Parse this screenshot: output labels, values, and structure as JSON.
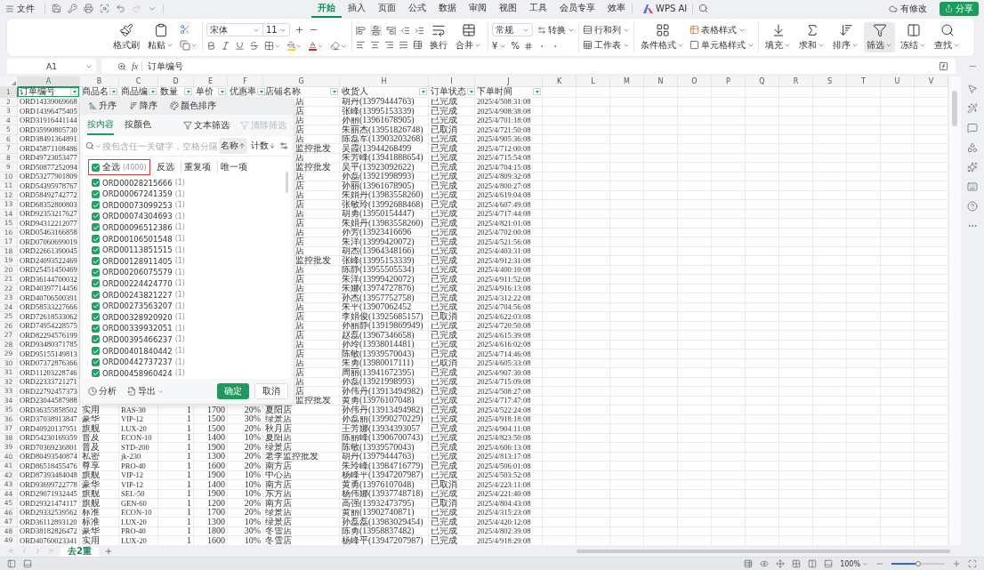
{
  "top_bar": {
    "menu": "文件",
    "tabs": [
      {
        "label": "开始",
        "selected": true
      },
      {
        "label": "插入",
        "selected": false
      },
      {
        "label": "页面",
        "selected": false
      },
      {
        "label": "公式",
        "selected": false
      },
      {
        "label": "数据",
        "selected": false
      },
      {
        "label": "审阅",
        "selected": false
      },
      {
        "label": "视图",
        "selected": false
      },
      {
        "label": "工具",
        "selected": false
      },
      {
        "label": "会员专享",
        "selected": false
      },
      {
        "label": "效率",
        "selected": false
      }
    ],
    "ai": "WPS AI",
    "status": "有修改",
    "share": "分享"
  },
  "ribbon": {
    "clipboard": [
      "格式刷",
      "粘贴"
    ],
    "font": {
      "name": "宋体",
      "size": "11"
    },
    "align": [
      "换行",
      "合并"
    ],
    "number": {
      "format": "常规",
      "convert": "转换",
      "currency": "¥",
      "percent": "%"
    },
    "table": [
      "行和列",
      "工作表"
    ],
    "style": [
      "条件格式",
      "表格样式",
      "单元格样式"
    ],
    "tools": [
      {
        "label": "填充",
        "selected": false
      },
      {
        "label": "求和",
        "selected": false
      },
      {
        "label": "排序",
        "selected": false
      },
      {
        "label": "筛选",
        "selected": true
      },
      {
        "label": "冻结",
        "selected": false
      },
      {
        "label": "查找",
        "selected": false
      }
    ]
  },
  "formula_bar": {
    "cell": "A1",
    "fx": "fx",
    "value": "订单编号"
  },
  "columns": [
    {
      "label": "A",
      "selected": true
    },
    {
      "label": "B",
      "selected": false
    },
    {
      "label": "C",
      "selected": false
    },
    {
      "label": "D",
      "selected": false
    },
    {
      "label": "E",
      "selected": false
    },
    {
      "label": "F",
      "selected": false
    },
    {
      "label": "G",
      "selected": false
    },
    {
      "label": "H",
      "selected": false
    },
    {
      "label": "I",
      "selected": false
    },
    {
      "label": "J",
      "selected": false
    },
    {
      "label": "K",
      "selected": false
    },
    {
      "label": "L",
      "selected": false
    },
    {
      "label": "M",
      "selected": false
    },
    {
      "label": "N",
      "selected": false
    },
    {
      "label": "O",
      "selected": false
    },
    {
      "label": "P",
      "selected": false
    },
    {
      "label": "Q",
      "selected": false
    },
    {
      "label": "R",
      "selected": false
    },
    {
      "label": "S",
      "selected": false
    },
    {
      "label": "T",
      "selected": false
    },
    {
      "label": "U",
      "selected": false
    },
    {
      "label": "V",
      "selected": false
    }
  ],
  "header_row": {
    "row": "1",
    "selected": true,
    "cells": [
      "订单编号",
      "商品名",
      "商品编",
      "数量",
      "单价",
      "优惠率",
      "店铺名称",
      "收货人",
      "订单状态",
      "下单时间"
    ]
  },
  "rows": [
    {
      "row": "2",
      "a": "ORD14339069668",
      "g": "店",
      "h": "胡丹(13979444763)",
      "i": "已完成",
      "j": "2025/4/508:31:08"
    },
    {
      "row": "3",
      "a": "ORD14396475405",
      "g": "店",
      "h": "张峰(13995153339)",
      "i": "已完成",
      "j": "2025/4/908:38:08"
    },
    {
      "row": "4",
      "a": "ORD31916441144",
      "g": "店",
      "h": "孙丽(13961678905)",
      "i": "已完成",
      "j": "2025/4/701:18:08"
    },
    {
      "row": "5",
      "a": "ORD35990805730",
      "g": "店",
      "h": "朱丽杰(13951826748)",
      "i": "已取消",
      "j": "2025/4/721:50:08"
    },
    {
      "row": "6",
      "a": "ORD38491364891",
      "g": "店",
      "h": "陈磊军(13903203268)",
      "i": "已完成",
      "j": "2025/4/905:36:08"
    },
    {
      "row": "7",
      "a": "ORD45871108486",
      "g": "监控批发",
      "h": "吴霞(13944268499",
      "i": "已完成",
      "j": "2025/4/712:00:08"
    },
    {
      "row": "8",
      "a": "ORD49723053477",
      "g": "店",
      "h": "朱芳峰(13941888654)",
      "i": "已完成",
      "j": "2025/4/715:54:08"
    },
    {
      "row": "9",
      "a": "ORD50877252094",
      "g": "监控批发",
      "h": "吴平(13923092622)",
      "i": "已完成",
      "j": "2025/4/704:15:08"
    },
    {
      "row": "10",
      "a": "ORD53277901809",
      "g": "店",
      "h": "孙磊(13921998993)",
      "i": "已完成",
      "j": "2025/4/809:32:08"
    },
    {
      "row": "11",
      "a": "ORD54395978767",
      "g": "店",
      "h": "孙丽(13961678905)",
      "i": "已完成",
      "j": "2025/4/800:27:08"
    },
    {
      "row": "12",
      "a": "ORD58492742772",
      "g": "店",
      "h": "朱娟丹(13983558260)",
      "i": "已完成",
      "j": "2025/4/619:04:08"
    },
    {
      "row": "13",
      "a": "ORD68352800803",
      "g": "店",
      "h": "张敏玲(13992688468)",
      "i": "已完成",
      "j": "2025/4/607:49:08"
    },
    {
      "row": "14",
      "a": "ORD92353217627",
      "g": "店",
      "h": "胡勇(13950154447)",
      "i": "已完成",
      "j": "2025/4/717:44:08"
    },
    {
      "row": "15",
      "a": "ORD94312212077",
      "g": "店",
      "h": "朱娟丹(13983558260)",
      "i": "已完成",
      "j": "2025/4/821:01:08"
    },
    {
      "row": "16",
      "a": "ORD05463166858",
      "g": "店",
      "h": "孙芳(13923416696",
      "i": "已完成",
      "j": "2025/4/702:00:08"
    },
    {
      "row": "17",
      "a": "ORD07060699019",
      "g": "店",
      "h": "朱洋(13999420072)",
      "i": "已完成",
      "j": "2025/4/521:56:08"
    },
    {
      "row": "18",
      "a": "ORD22661390045",
      "g": "店",
      "h": "胡杰(13964348166)",
      "i": "已完成",
      "j": "2025/4/403:31:08"
    },
    {
      "row": "19",
      "a": "ORD24093522469",
      "g": "监控批发",
      "h": "张峰(13995153339)",
      "i": "已完成",
      "j": "2025/4/912:31:08"
    },
    {
      "row": "20",
      "a": "ORD25451450469",
      "g": "店",
      "h": "陈静(13955505534)",
      "i": "已完成",
      "j": "2025/4/400:10:08"
    },
    {
      "row": "21",
      "a": "ORD36144700032",
      "g": "店",
      "h": "朱洋(13999420072)",
      "i": "已完成",
      "j": "2025/4/911:52:08"
    },
    {
      "row": "22",
      "a": "ORD40397714456",
      "g": "店",
      "h": "朱娜(13974727876)",
      "i": "已完成",
      "j": "2025/4/916:13:08"
    },
    {
      "row": "23",
      "a": "ORD40706500391",
      "g": "店",
      "h": "孙杰(13957752758)",
      "i": "已完成",
      "j": "2025/4/312:22:08"
    },
    {
      "row": "24",
      "a": "ORD58533227666",
      "g": "店",
      "h": "朱平(13907062452",
      "i": "已完成",
      "j": "2025/4/704:56:08"
    },
    {
      "row": "25",
      "a": "ORD72618533062",
      "g": "店",
      "h": "李娟俊(13925685157)",
      "i": "已取消",
      "j": "2025/4/622:03:08"
    },
    {
      "row": "26",
      "a": "ORD74954228575",
      "g": "店",
      "h": "孙丽静(13919869949)",
      "i": "已完成",
      "j": "2025/4/720:50:08"
    },
    {
      "row": "27",
      "a": "ORD82294576199",
      "g": "店",
      "h": "赵磊(13967346658)",
      "i": "已完成",
      "j": "2025/4/615:39:08"
    },
    {
      "row": "28",
      "a": "ORD93480371785",
      "g": "店",
      "h": "孙玲(13938014481)",
      "i": "已完成",
      "j": "2025/4/616:02:08"
    },
    {
      "row": "29",
      "a": "ORD95155149813",
      "g": "店",
      "h": "陈敏(13939570043)",
      "i": "已完成",
      "j": "2025/4/714:46:08"
    },
    {
      "row": "30",
      "a": "ORD07372876366",
      "g": "店",
      "h": "朱勇(13980017111)",
      "i": "已取消",
      "j": "2025/4/605:33:08"
    },
    {
      "row": "31",
      "a": "ORD11203228746",
      "g": "店",
      "h": "周丽(13941672395)",
      "i": "已完成",
      "j": "2025/4/907:30:08"
    },
    {
      "row": "32",
      "a": "ORD22333721271",
      "g": "店",
      "h": "孙磊(13921998993)",
      "i": "已完成",
      "j": "2025/4/715:09:08"
    },
    {
      "row": "33",
      "a": "ORD22792457373",
      "g": "店",
      "h": "孙伟丹(13913494982)",
      "i": "已完成",
      "j": "2025/4/508:27:08"
    },
    {
      "row": "34",
      "a": "ORD23044587988",
      "g": "监控批发",
      "h": "黄勇(13976107048)",
      "i": "已完成",
      "j": "2025/4/717:47:08"
    },
    {
      "row": "35",
      "a": "ORD36355858502",
      "b": "实用",
      "c": "BAS-30",
      "d": "1",
      "e": "1700",
      "f": "20%",
      "g": "夏阳店",
      "h": "孙伟丹(13913494982)",
      "i": "已完成",
      "j": "2025/4/522:24:08"
    },
    {
      "row": "36",
      "a": "ORD37038913847",
      "b": "豪华",
      "c": "VIP-12",
      "d": "1",
      "e": "1500",
      "f": "30%",
      "g": "绿景店",
      "h": "孙磊丽(13990270229)",
      "i": "已完成",
      "j": "2025/4/918:18:08"
    },
    {
      "row": "37",
      "a": "ORD40920137951",
      "b": "旗舰",
      "c": "LUX-20",
      "d": "1",
      "e": "1500",
      "f": "20%",
      "g": "秋月店",
      "h": "王芳娜(13934393057",
      "i": "已完成",
      "j": "2025/4/904:11:08"
    },
    {
      "row": "38",
      "a": "ORD54230169359",
      "b": "普及",
      "c": "ECON-10",
      "d": "1",
      "e": "1400",
      "f": "10%",
      "g": "夏阳店",
      "h": "陈丽峰(13906700743)",
      "i": "已完成",
      "j": "2025/4/823:50:08"
    },
    {
      "row": "39",
      "a": "ORD70369236801",
      "b": "普及",
      "c": "STD-200",
      "d": "1",
      "e": "1900",
      "f": "20%",
      "g": "绿景店",
      "h": "陈敏(13939570043)",
      "i": "已完成",
      "j": "2025/4/606:13:08"
    },
    {
      "row": "40",
      "a": "ORD80493540874",
      "b": "私密",
      "c": "jk-230",
      "d": "1",
      "e": "1300",
      "f": "20%",
      "g": "老李监控批发",
      "h": "胡丹(13979444763)",
      "i": "已完成",
      "j": "2025/4/813:17:08"
    },
    {
      "row": "41",
      "a": "ORD86518455476",
      "b": "尊享",
      "c": "PRO-40",
      "d": "1",
      "e": "1600",
      "f": "20%",
      "g": "南方店",
      "h": "朱玲峰(13984716779)",
      "i": "已完成",
      "j": "2025/4/506:01:08"
    },
    {
      "row": "42",
      "a": "ORD87393484048",
      "b": "旗舰",
      "c": "VIP-12",
      "d": "1",
      "e": "1900",
      "f": "10%",
      "g": "中心店",
      "h": "杨峰平(13947207987)",
      "i": "已完成",
      "j": "2025/4/503:52:08"
    },
    {
      "row": "43",
      "a": "ORD93699722778",
      "b": "豪华",
      "c": "VIP-12",
      "d": "1",
      "e": "1400",
      "f": "10%",
      "g": "南方店",
      "h": "黄勇(13976107048)",
      "i": "已取消",
      "j": "2025/4/223:11:08"
    },
    {
      "row": "44",
      "a": "ORD29071932445",
      "b": "旗舰",
      "c": "SEL-50",
      "d": "1",
      "e": "1900",
      "f": "10%",
      "g": "东方店",
      "h": "杨伟娜(13937748718)",
      "i": "已完成",
      "j": "2025/4/221:40:08"
    },
    {
      "row": "45",
      "a": "ORD29321474117",
      "b": "旗舰",
      "c": "GEN-60",
      "d": "1",
      "e": "1200",
      "f": "20%",
      "g": "南方店",
      "h": "高强(13932473795)",
      "i": "已取消",
      "j": "2025/4/804:43:08"
    },
    {
      "row": "46",
      "a": "ORD29332539562",
      "b": "标准",
      "c": "ECON-10",
      "d": "1",
      "e": "1700",
      "f": "20%",
      "g": "绿景店",
      "h": "黄丽(13902740871)",
      "i": "已完成",
      "j": "2025/4/315:23:08"
    },
    {
      "row": "47",
      "a": "ORD36112893120",
      "b": "标准",
      "c": "LUX-20",
      "d": "1",
      "e": "1300",
      "f": "10%",
      "g": "绿景店",
      "h": "孙磊磊(13983029454)",
      "i": "已完成",
      "j": "2025/4/420:12:08"
    },
    {
      "row": "48",
      "a": "ORD38182826472",
      "b": "豪华",
      "c": "PRO-40",
      "d": "1",
      "e": "1800",
      "f": "30%",
      "g": "冬雪店",
      "h": "陈勇(13958837482)",
      "i": "已完成",
      "j": "2025/4/802:39:08"
    },
    {
      "row": "49",
      "a": "ORD40760023341",
      "b": "实用",
      "c": "LUX-20",
      "d": "1",
      "e": "1600",
      "f": "10%",
      "g": "冬雪店",
      "h": "杨峰平(13947207987)",
      "i": "已完成",
      "j": "2025/4/918:29:08"
    }
  ],
  "filter_popup": {
    "sort": [
      "升序",
      "降序",
      "颜色排序"
    ],
    "tabs": [
      {
        "label": "按内容",
        "selected": true
      },
      {
        "label": "按颜色",
        "selected": false
      }
    ],
    "text_filter": "文本筛选",
    "clear_filter": {
      "label": "清除筛选",
      "disabled": true
    },
    "search": {
      "placeholder": "搜包含任一关键字，空格分隔"
    },
    "order": [
      {
        "label": "名称",
        "selected": true
      },
      {
        "label": "计数",
        "selected": false
      }
    ],
    "select_all": {
      "label": "全选",
      "count": "(4000)",
      "checked": true,
      "highlighted": true
    },
    "quick": [
      "反选",
      "重复项",
      "唯一项"
    ],
    "items": [
      {
        "label": "ORD00028215666",
        "count": "(1)",
        "checked": true
      },
      {
        "label": "ORD00067241359",
        "count": "(1)",
        "checked": true
      },
      {
        "label": "ORD00073099253",
        "count": "(1)",
        "checked": true
      },
      {
        "label": "ORD00074304693",
        "count": "(1)",
        "checked": true
      },
      {
        "label": "ORD00096512386",
        "count": "(1)",
        "checked": true
      },
      {
        "label": "ORD00106501548",
        "count": "(1)",
        "checked": true
      },
      {
        "label": "ORD00113851515",
        "count": "(1)",
        "checked": true
      },
      {
        "label": "ORD00128911405",
        "count": "(1)",
        "checked": true
      },
      {
        "label": "ORD00206075579",
        "count": "(1)",
        "checked": true
      },
      {
        "label": "ORD00224424770",
        "count": "(1)",
        "checked": true
      },
      {
        "label": "ORD00243821227",
        "count": "(1)",
        "checked": true
      },
      {
        "label": "ORD00273563207",
        "count": "(1)",
        "checked": true
      },
      {
        "label": "ORD00328920920",
        "count": "(1)",
        "checked": true
      },
      {
        "label": "ORD00339932051",
        "count": "(1)",
        "checked": true
      },
      {
        "label": "ORD00395466237",
        "count": "(1)",
        "checked": true
      },
      {
        "label": "ORD00401840442",
        "count": "(1)",
        "checked": true
      },
      {
        "label": "ORD00442737237",
        "count": "(1)",
        "checked": true
      },
      {
        "label": "ORD00458960424",
        "count": "(1)",
        "checked": true
      }
    ],
    "footer": {
      "analyze": "分析",
      "export": "导出",
      "ok": "确定",
      "cancel": "取消"
    }
  },
  "sheet_tabs": [
    {
      "label": "去2重",
      "selected": true
    }
  ],
  "status_bar": {
    "zoom": "100%",
    "zoom_slider": {
      "level": 0.5
    }
  }
}
